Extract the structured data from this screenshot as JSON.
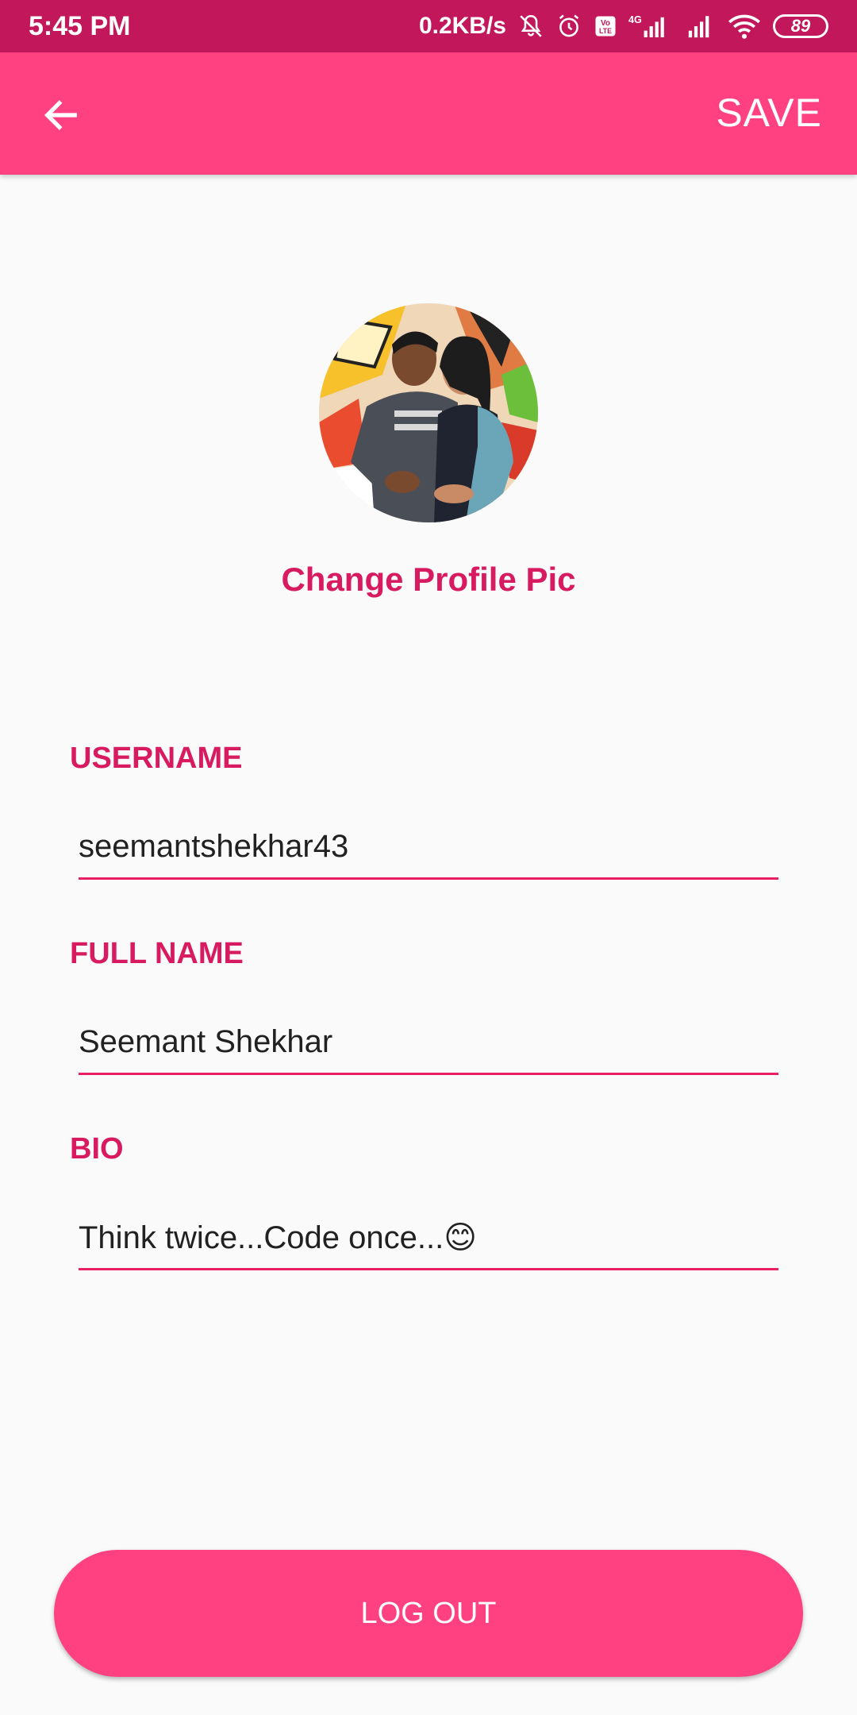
{
  "status_bar": {
    "time": "5:45 PM",
    "network_speed": "0.2KB/s",
    "network_type": "4G",
    "volte": "Vo LTE",
    "battery": "89",
    "icons": [
      "mute-bell-icon",
      "alarm-icon",
      "volte-icon",
      "signal-icon",
      "signal-icon",
      "wifi-icon",
      "battery-icon"
    ],
    "background_color": "#c2185b"
  },
  "app_bar": {
    "back_icon": "arrow-back-icon",
    "save_label": "SAVE",
    "background_color": "#ff4081"
  },
  "profile": {
    "avatar_alt": "profile picture",
    "change_pic_label": "Change Profile Pic"
  },
  "form": {
    "username_label": "USERNAME",
    "username_value": "seemantshekhar43",
    "fullname_label": "FULL NAME",
    "fullname_value": "Seemant Shekhar",
    "bio_label": "BIO",
    "bio_value": "Think twice...Code once...😊"
  },
  "logout": {
    "label": "LOG OUT"
  },
  "colors": {
    "accent": "#ff4081",
    "label": "#d81b60",
    "underline": "#e91e63"
  }
}
